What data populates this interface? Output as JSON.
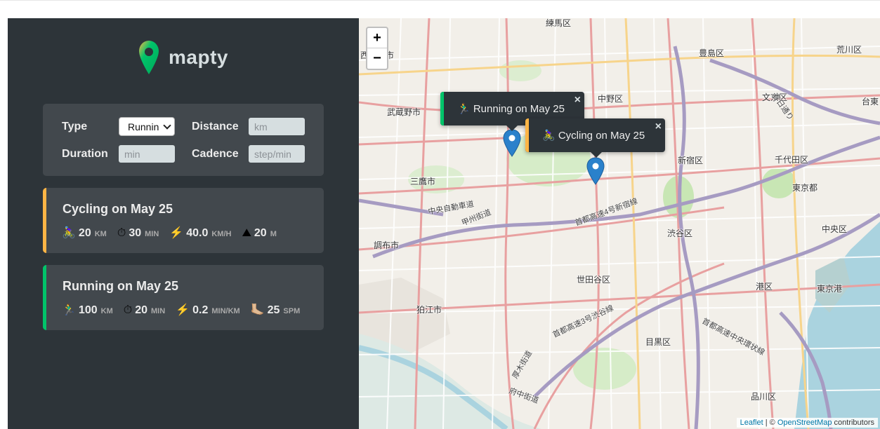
{
  "app": {
    "name": "mapty",
    "accent_running": "#00c46a",
    "accent_cycling": "#ffb545"
  },
  "form": {
    "type_label": "Type",
    "type_value": "Running",
    "distance_label": "Distance",
    "distance_placeholder": "km",
    "duration_label": "Duration",
    "duration_placeholder": "min",
    "cadence_label": "Cadence",
    "cadence_placeholder": "step/min"
  },
  "workouts": [
    {
      "type": "cycling",
      "title": "Cycling on May 25",
      "details": [
        {
          "icon": "🚴‍♀️",
          "icon_name": "cyclist-icon",
          "value": "20",
          "unit": "km"
        },
        {
          "icon": "⏱",
          "icon_name": "stopwatch-icon",
          "value": "30",
          "unit": "min"
        },
        {
          "icon": "⚡️",
          "icon_name": "lightning-icon",
          "value": "40.0",
          "unit": "km/h"
        },
        {
          "icon": "⛰",
          "icon_name": "mountain-icon",
          "value": "20",
          "unit": "m"
        }
      ]
    },
    {
      "type": "running",
      "title": "Running on May 25",
      "details": [
        {
          "icon": "🏃‍♂️",
          "icon_name": "runner-icon",
          "value": "100",
          "unit": "km"
        },
        {
          "icon": "⏱",
          "icon_name": "stopwatch-icon",
          "value": "20",
          "unit": "min"
        },
        {
          "icon": "⚡️",
          "icon_name": "lightning-icon",
          "value": "0.2",
          "unit": "min/km"
        },
        {
          "icon": "🦶🏼",
          "icon_name": "foot-icon",
          "value": "25",
          "unit": "spm"
        }
      ]
    }
  ],
  "map": {
    "zoom_in": "+",
    "zoom_out": "−",
    "popups": {
      "running": "🏃‍♂️ Running on May 25",
      "cycling": "🚴‍♀️ Cycling on May 25",
      "close": "×"
    },
    "places": {
      "nerima": "練馬区",
      "nishitokyo": "西東京市",
      "toshima": "豊島区",
      "arakawa": "荒川区",
      "nakano": "中野区",
      "bunkyo": "文京区",
      "taito": "台東",
      "musashino": "武蔵野市",
      "shinjuku": "新宿区",
      "chiyoda": "千代田区",
      "mitaka": "三鷹市",
      "tokyoto": "東京都",
      "chofu": "調布市",
      "shibuya": "渋谷区",
      "chuo": "中央区",
      "setagaya": "世田谷区",
      "minato": "港区",
      "komae": "狛江市",
      "tokyoko": "東京港",
      "meguro": "目黒区",
      "shinagawa": "品川区"
    },
    "roads": {
      "chuo_expressway": "中央自動車道",
      "koshu_kaido": "甲州街道",
      "shinjuku_route": "首都高速4号新宿線",
      "shibuya_route": "首都高速3号渋谷線",
      "central_loop": "首都高速中央環状線",
      "atsugi_kaido": "厚木街道",
      "kasuga_dori": "春日通り",
      "fuchu_kaido": "府中街道"
    },
    "attribution": {
      "leaflet": "Leaflet",
      "sep": " | © ",
      "osm": "OpenStreetMap",
      "contributors": " contributors"
    }
  }
}
